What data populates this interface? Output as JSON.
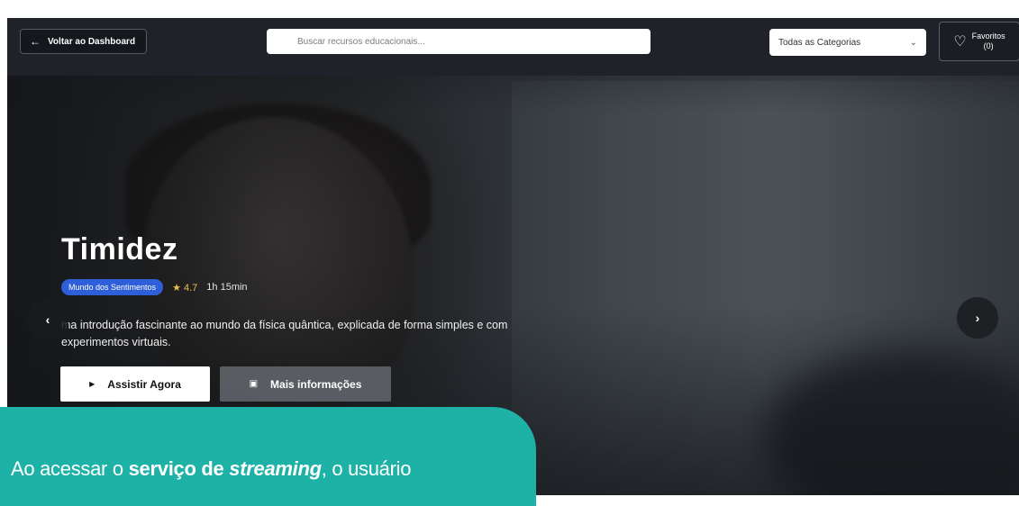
{
  "topbar": {
    "back_label": "Voltar ao Dashboard",
    "search_placeholder": "Buscar recursos educacionais...",
    "category_value": "Todas as Categorias",
    "favorites_label": "Favoritos",
    "favorites_count": "(0)"
  },
  "hero": {
    "title": "Timidez",
    "category": "Mundo dos Sentimentos",
    "rating_star": "★",
    "rating": "4.7",
    "duration": "1h 15min",
    "description": "ma introdução fascinante ao mundo da física quântica, explicada de forma simples e com experimentos virtuais.",
    "watch_label": "Assistir Agora",
    "info_label": "Mais informações",
    "prev_glyph": "‹",
    "next_glyph": "›"
  },
  "caption": {
    "part1": "Ao acessar o ",
    "bold": "serviço de ",
    "bold_italic": "streaming",
    "part2": ", o usuário"
  },
  "icons": {
    "back": "arrow-left-icon",
    "favorite": "heart-icon",
    "chevron": "chevron-down-icon",
    "play": "play-icon",
    "info": "document-icon"
  },
  "colors": {
    "accent_badge": "#2f5fd8",
    "rating": "#e7c04a",
    "caption_bg": "#1eb1a6"
  }
}
